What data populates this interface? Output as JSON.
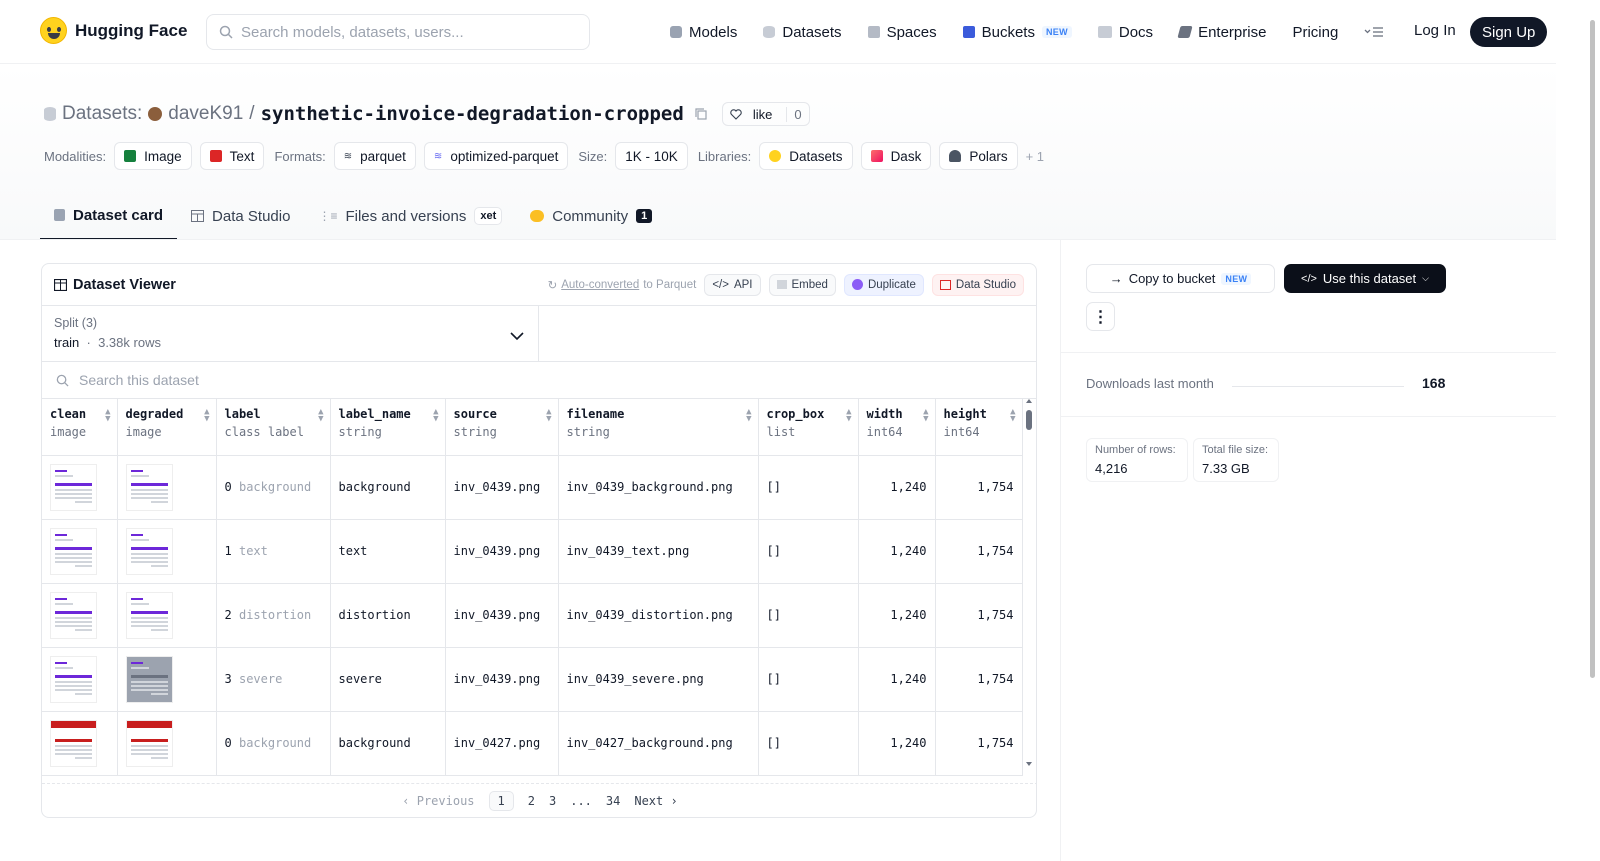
{
  "brand": {
    "name": "Hugging Face"
  },
  "search": {
    "placeholder": "Search models, datasets, users..."
  },
  "nav": {
    "items": [
      {
        "label": "Models",
        "icon": "models-icon"
      },
      {
        "label": "Datasets",
        "icon": "datasets-icon"
      },
      {
        "label": "Spaces",
        "icon": "spaces-icon"
      },
      {
        "label": "Buckets",
        "icon": "buckets-icon",
        "badge": "NEW"
      },
      {
        "label": "Docs",
        "icon": "docs-icon"
      },
      {
        "label": "Enterprise",
        "icon": "enterprise-icon"
      },
      {
        "label": "Pricing"
      }
    ],
    "login": "Log In",
    "signup": "Sign Up"
  },
  "breadcrumb": {
    "section": "Datasets:",
    "user": "daveK91",
    "separator": "/",
    "name": "synthetic-invoice-degradation-cropped",
    "like_label": "like",
    "like_count": "0"
  },
  "tags": {
    "modalities_label": "Modalities:",
    "modalities": [
      "Image",
      "Text"
    ],
    "formats_label": "Formats:",
    "formats": [
      "parquet",
      "optimized-parquet"
    ],
    "size_label": "Size:",
    "size": "1K - 10K",
    "libraries_label": "Libraries:",
    "libraries": [
      "Datasets",
      "Dask",
      "Polars"
    ],
    "libraries_more": "+ 1"
  },
  "tabs": [
    {
      "label": "Dataset card",
      "active": true
    },
    {
      "label": "Data Studio"
    },
    {
      "label": "Files and versions",
      "badge": "xet"
    },
    {
      "label": "Community",
      "badge": "1"
    }
  ],
  "viewer": {
    "title": "Dataset Viewer",
    "auto_converted": "Auto-converted",
    "auto_converted_suffix": "to Parquet",
    "buttons": [
      "API",
      "Embed",
      "Duplicate",
      "Data Studio"
    ],
    "split_label": "Split (3)",
    "split_value": "train",
    "split_rows": "3.38k rows",
    "search_placeholder": "Search this dataset",
    "columns": [
      {
        "name": "clean",
        "type": "image"
      },
      {
        "name": "degraded",
        "type": "image"
      },
      {
        "name": "label",
        "type": "class label"
      },
      {
        "name": "label_name",
        "type": "string"
      },
      {
        "name": "source",
        "type": "string"
      },
      {
        "name": "filename",
        "type": "string"
      },
      {
        "name": "crop_box",
        "type": "list"
      },
      {
        "name": "width",
        "type": "int64"
      },
      {
        "name": "height",
        "type": "int64"
      }
    ],
    "rows": [
      {
        "label_id": "0",
        "label_class": "background",
        "label_name": "background",
        "source": "inv_0439.png",
        "filename": "inv_0439_background.png",
        "crop_box": "[]",
        "width": "1,240",
        "height": "1,754",
        "theme": "purple"
      },
      {
        "label_id": "1",
        "label_class": "text",
        "label_name": "text",
        "source": "inv_0439.png",
        "filename": "inv_0439_text.png",
        "crop_box": "[]",
        "width": "1,240",
        "height": "1,754",
        "theme": "purple"
      },
      {
        "label_id": "2",
        "label_class": "distortion",
        "label_name": "distortion",
        "source": "inv_0439.png",
        "filename": "inv_0439_distortion.png",
        "crop_box": "[]",
        "width": "1,240",
        "height": "1,754",
        "theme": "purple"
      },
      {
        "label_id": "3",
        "label_class": "severe",
        "label_name": "severe",
        "source": "inv_0439.png",
        "filename": "inv_0439_severe.png",
        "crop_box": "[]",
        "width": "1,240",
        "height": "1,754",
        "theme": "purple"
      },
      {
        "label_id": "0",
        "label_class": "background",
        "label_name": "background",
        "source": "inv_0427.png",
        "filename": "inv_0427_background.png",
        "crop_box": "[]",
        "width": "1,240",
        "height": "1,754",
        "theme": "red"
      }
    ],
    "pager": {
      "prev": "Previous",
      "pages": [
        "1",
        "2",
        "3",
        "...",
        "34"
      ],
      "next": "Next",
      "current": "1"
    }
  },
  "sidebar": {
    "copy_label": "Copy to bucket",
    "copy_badge": "NEW",
    "use_label": "Use this dataset",
    "downloads_label": "Downloads last month",
    "downloads_value": "168",
    "stats": [
      {
        "label": "Number of rows:",
        "value": "4,216"
      },
      {
        "label": "Total file size:",
        "value": "7.33 GB"
      }
    ]
  },
  "colors": {
    "accent": "#111827",
    "purple_theme": "#6d28d9",
    "red_theme": "#c81e1e"
  }
}
